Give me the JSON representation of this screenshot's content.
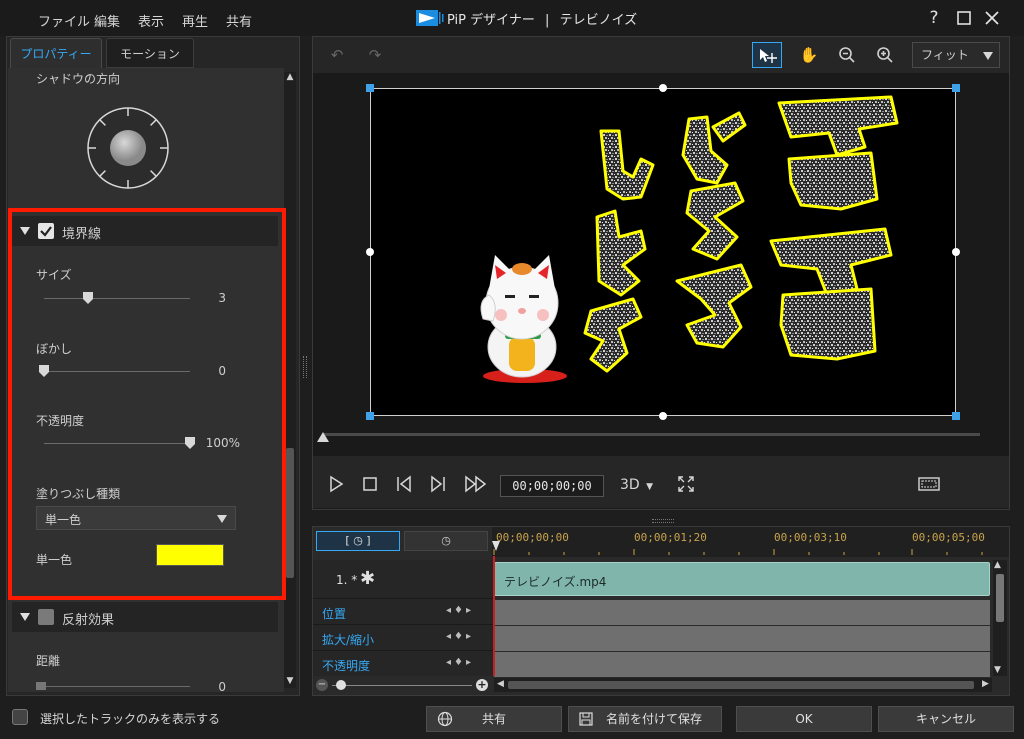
{
  "menu": {
    "file": "ファイル",
    "edit": "編集",
    "view": "表示",
    "play": "再生",
    "share": "共有"
  },
  "title": {
    "app": "PiP デザイナー",
    "separator": "|",
    "document": "テレビノイズ"
  },
  "window": {
    "help": "?"
  },
  "tabs": {
    "properties": "プロパティー",
    "motion": "モーション"
  },
  "properties": {
    "shadow_direction_label": "シャドウの方向",
    "border": {
      "title": "境界線",
      "checked": true,
      "size_label": "サイズ",
      "size_value": "3",
      "size_fraction": 0.3,
      "blur_label": "ぼかし",
      "blur_value": "0",
      "blur_fraction": 0.0,
      "opacity_label": "不透明度",
      "opacity_value": "100%",
      "opacity_fraction": 1.0,
      "fill_type_label": "塗りつぶし種類",
      "fill_type_value": "単一色",
      "solid_color_label": "単一色",
      "solid_color": "#ffff00"
    },
    "reflection": {
      "title": "反射効果",
      "checked": false,
      "distance_label": "距離",
      "distance_value": "0"
    }
  },
  "preview": {
    "fit_label": "フィット",
    "timecode": "00;00;00;00",
    "mode_3d": "3D"
  },
  "timeline": {
    "ruler": [
      "00;00;00;00",
      "00;00;01;20",
      "00;00;03;10",
      "00;00;05;00"
    ],
    "track_name": "1. *",
    "clip_name": "テレビノイズ.mp4",
    "attributes": [
      "位置",
      "拡大/縮小",
      "不透明度"
    ]
  },
  "footer": {
    "show_selected_only": "選択したトラックのみを表示する",
    "share": "共有",
    "save_as": "名前を付けて保存",
    "ok": "OK",
    "cancel": "キャンセル"
  },
  "colors": {
    "accent": "#36a9f4",
    "highlight": "#ff1a00",
    "clip": "#7fb5ab"
  }
}
